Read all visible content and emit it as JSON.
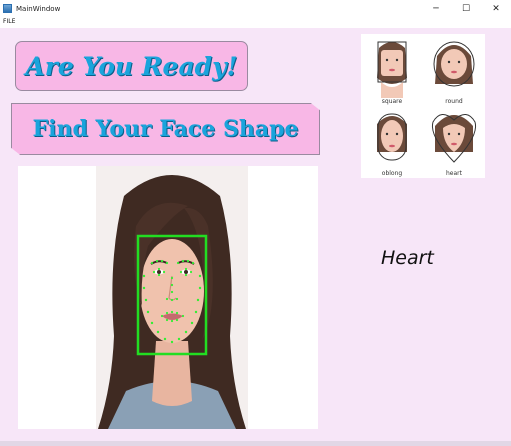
{
  "window": {
    "title": "MainWindow",
    "minimize": "─",
    "maximize": "☐",
    "close": "✕"
  },
  "menu": {
    "file": "FILE"
  },
  "banners": {
    "ready": "Are You Ready!",
    "find": "Find Your Face Shape"
  },
  "shapes": [
    {
      "label": "square",
      "icon": "square-face-icon"
    },
    {
      "label": "round",
      "icon": "round-face-icon"
    },
    {
      "label": "oblong",
      "icon": "oblong-face-icon"
    },
    {
      "label": "heart",
      "icon": "heart-face-icon"
    }
  ],
  "result": {
    "text": "Heart"
  },
  "colors": {
    "background": "#f7e6f8",
    "banner_fill": "#f8b7e6",
    "banner_text": "#1aa4dc",
    "detection_box": "#22dd22"
  }
}
